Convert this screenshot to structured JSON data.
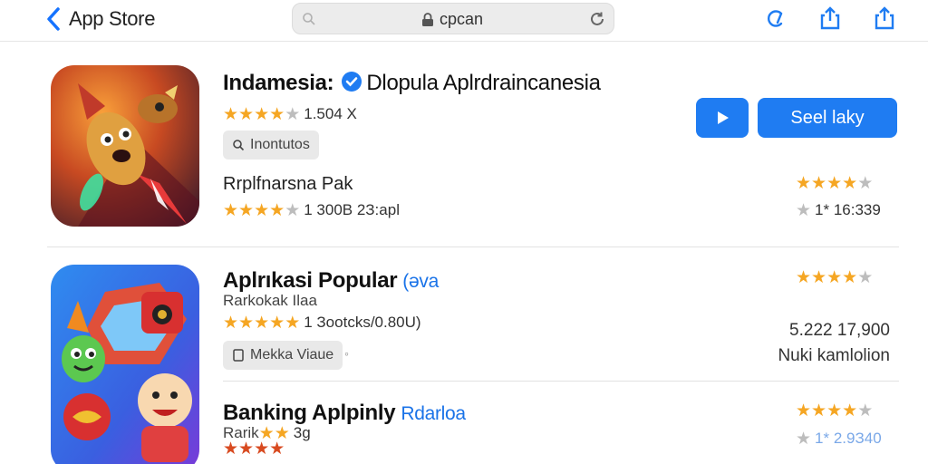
{
  "topbar": {
    "back_label": "App Store",
    "address_text": "cpcan"
  },
  "apps": [
    {
      "title": "Indamesia:",
      "title_sub": "Dlopula Aplrdraincanesia",
      "rating_text": "1.504 X",
      "chip_label": "Inontutos",
      "line2": "Rrplfnarsna Pak",
      "rating2_text": "1 300B 2З:apl",
      "right_line": "1* 16:339",
      "get_label": "Seel laky"
    },
    {
      "title": "Aplrıkasi Popular",
      "tag": "(əva",
      "subtitle": "Rarkokak Ilaa",
      "rating_text": "1 Зootcks/0.80U)",
      "chip_label": "Mekka Viaue",
      "right_line1": "5.222 17,900",
      "right_line2": "Nuki kamlolion"
    },
    {
      "title": "Banking Aplpinly",
      "tag": "Rdarloa",
      "subtitle": "Rarik",
      "subtitle_tail": "3g",
      "right_line": "1* 2.9З40"
    }
  ],
  "colors": {
    "accent": "#1f7cf2",
    "star": "#f5a623",
    "star_inactive": "#bdbdbd"
  },
  "icons": [
    "back-chevron-icon",
    "search-icon",
    "lock-icon",
    "reload-icon",
    "accessibility-icon",
    "share-icon",
    "share-alt-icon",
    "verified-icon",
    "play-icon"
  ]
}
